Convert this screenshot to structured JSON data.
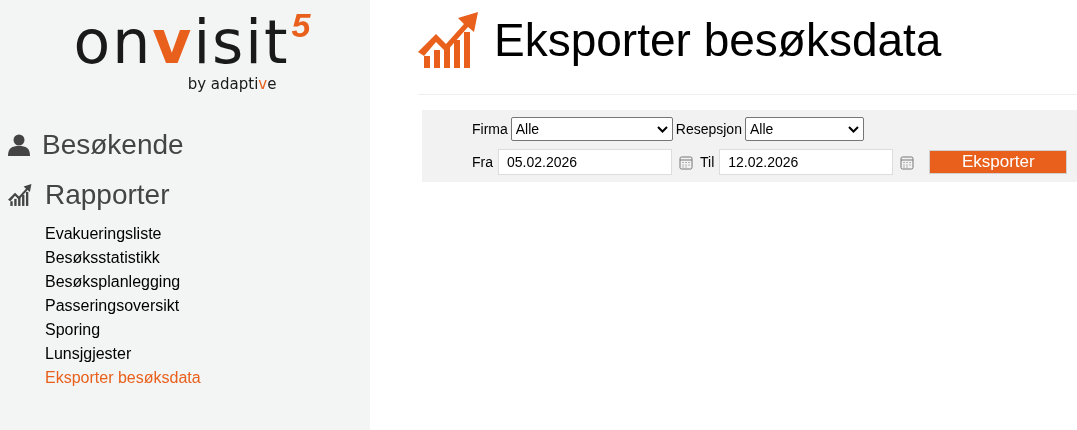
{
  "logo": {
    "name_before": "on",
    "name_accent": "v",
    "name_after": "isit",
    "version": "5",
    "tagline_before": "by adapti",
    "tagline_accent": "v",
    "tagline_after": "e"
  },
  "sidebar": {
    "sections": [
      {
        "label": "Besøkende",
        "kind": "visitors"
      },
      {
        "label": "Rapporter",
        "kind": "reports",
        "items": [
          {
            "label": "Evakueringsliste",
            "selected": false
          },
          {
            "label": "Besøksstatistikk",
            "selected": false
          },
          {
            "label": "Besøksplanlegging",
            "selected": false
          },
          {
            "label": "Passeringsoversikt",
            "selected": false
          },
          {
            "label": "Sporing",
            "selected": false
          },
          {
            "label": "Lunsjgjester",
            "selected": false
          },
          {
            "label": "Eksporter besøksdata",
            "selected": true
          }
        ]
      }
    ]
  },
  "page": {
    "title": "Eksporter besøksdata"
  },
  "filters": {
    "firma": {
      "label": "Firma",
      "value": "Alle"
    },
    "resepsjon": {
      "label": "Resepsjon",
      "value": "Alle"
    },
    "fra": {
      "label": "Fra",
      "value": "05.02.2026"
    },
    "til": {
      "label": "Til",
      "value": "12.02.2026"
    },
    "button": "Eksporter"
  }
}
